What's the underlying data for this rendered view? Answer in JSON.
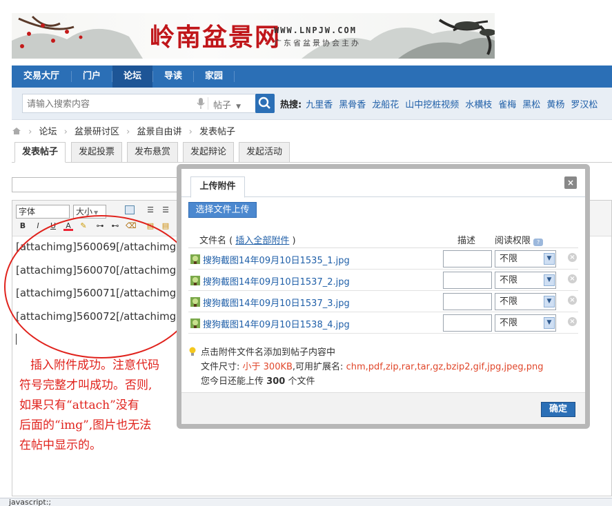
{
  "banner": {
    "logo_text": "岭南盆景网",
    "url": "WWW.LNPJW.COM",
    "subtitle": "广东省盆景协会主办"
  },
  "nav": {
    "items": [
      {
        "label": "交易大厅"
      },
      {
        "label": "门户"
      },
      {
        "label": "论坛"
      },
      {
        "label": "导读"
      },
      {
        "label": "家园"
      }
    ],
    "active": "论坛"
  },
  "search": {
    "placeholder": "请输入搜索内容",
    "scope": "帖子",
    "hot_label": "热搜:",
    "hot_links": [
      "九里香",
      "黑骨香",
      "龙船花",
      "山中挖桩视频",
      "水横枝",
      "雀梅",
      "黑松",
      "黄杨",
      "罗汉松"
    ]
  },
  "breadcrumb": [
    "论坛",
    "盆景研讨区",
    "盆景自由讲",
    "发表帖子"
  ],
  "tabs": [
    {
      "label": "发表帖子"
    },
    {
      "label": "发起投票"
    },
    {
      "label": "发布悬赏"
    },
    {
      "label": "发起辩论"
    },
    {
      "label": "发起活动"
    }
  ],
  "editor": {
    "font_select": "字体",
    "size_select": "大小",
    "lines": [
      "[attachimg]560069[/attachimg]",
      "[attachimg]560070[/attachimg]",
      "[attachimg]560071[/attachimg]",
      "[attachimg]560072[/attachimg]"
    ]
  },
  "annotation": {
    "lines": [
      "插入附件成功。注意代码",
      "符号完整才叫成功。否则,",
      "如果只有“attach”没有",
      "后面的“img”,图片也无法",
      "在帖中显示的。"
    ],
    "color": "#e0221c"
  },
  "dialog": {
    "tab_label": "上传附件",
    "close_label": "×",
    "upload_button": "选择文件上传",
    "col_filename": "文件名 (",
    "insert_all_link": "插入全部附件",
    "col_filename_end": ")",
    "col_desc": "描述",
    "col_perm": "阅读权限",
    "files": [
      {
        "name": "搜狗截图14年09月10日1535_1.jpg",
        "perm": "不限"
      },
      {
        "name": "搜狗截图14年09月10日1537_2.jpg",
        "perm": "不限"
      },
      {
        "name": "搜狗截图14年09月10日1537_3.jpg",
        "perm": "不限"
      },
      {
        "name": "搜狗截图14年09月10日1538_4.jpg",
        "perm": "不限"
      }
    ],
    "tip": "点击附件文件名添加到帖子内容中",
    "size_label": "文件尺寸:",
    "size_value": "小于 300KB",
    "ext_label": ",可用扩展名:",
    "ext_value": "chm,pdf,zip,rar,tar,gz,bzip2,gif,jpg,jpeg,png",
    "remain_prefix": "您今日还能上传",
    "remain_count": "300",
    "remain_suffix": "个文件",
    "confirm": "确定"
  },
  "status_bar": "javascript:;"
}
